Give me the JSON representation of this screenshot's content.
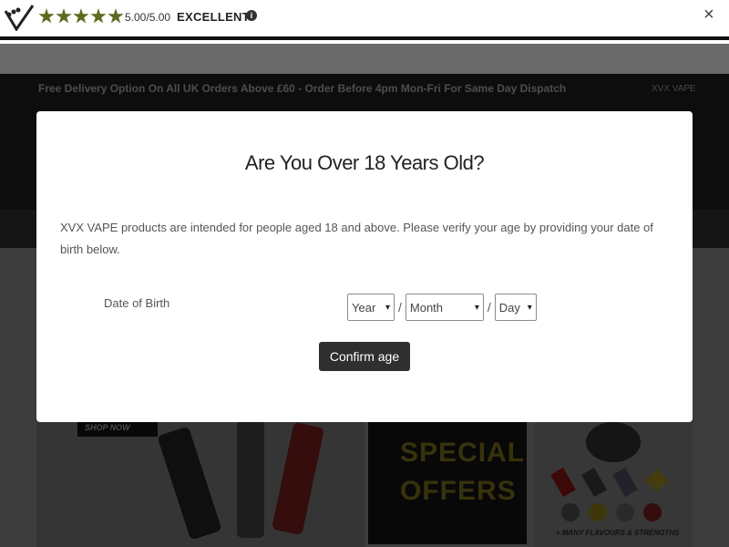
{
  "review_bar": {
    "score": "5.00/5.00",
    "rating_word": "EXCELLENT",
    "info_icon": "info-icon",
    "close_label": "×",
    "star_color": "#5a6b1e"
  },
  "background": {
    "promo_text": "Free Delivery Option On All UK Orders Above £60 - Order Before 4pm Mon-Fri For Same Day Dispatch",
    "promo_brand": "XVX VAPE",
    "shop_now": "SHOP NOW",
    "special_line1": "SPECIAL",
    "special_line2": "OFFERS",
    "flavours_text": "+ MANY FLAVOURS & STRENGTHS"
  },
  "age_modal": {
    "title": "Are You Over 18 Years Old?",
    "description": "XVX VAPE products are intended for people aged 18 and above. Please verify your age by providing your date of birth below.",
    "dob_label": "Date of Birth",
    "year_value": "Year",
    "month_value": "Month",
    "day_value": "Day",
    "separator": "/",
    "confirm_label": "Confirm age",
    "button_color": "#2f2f2f"
  }
}
